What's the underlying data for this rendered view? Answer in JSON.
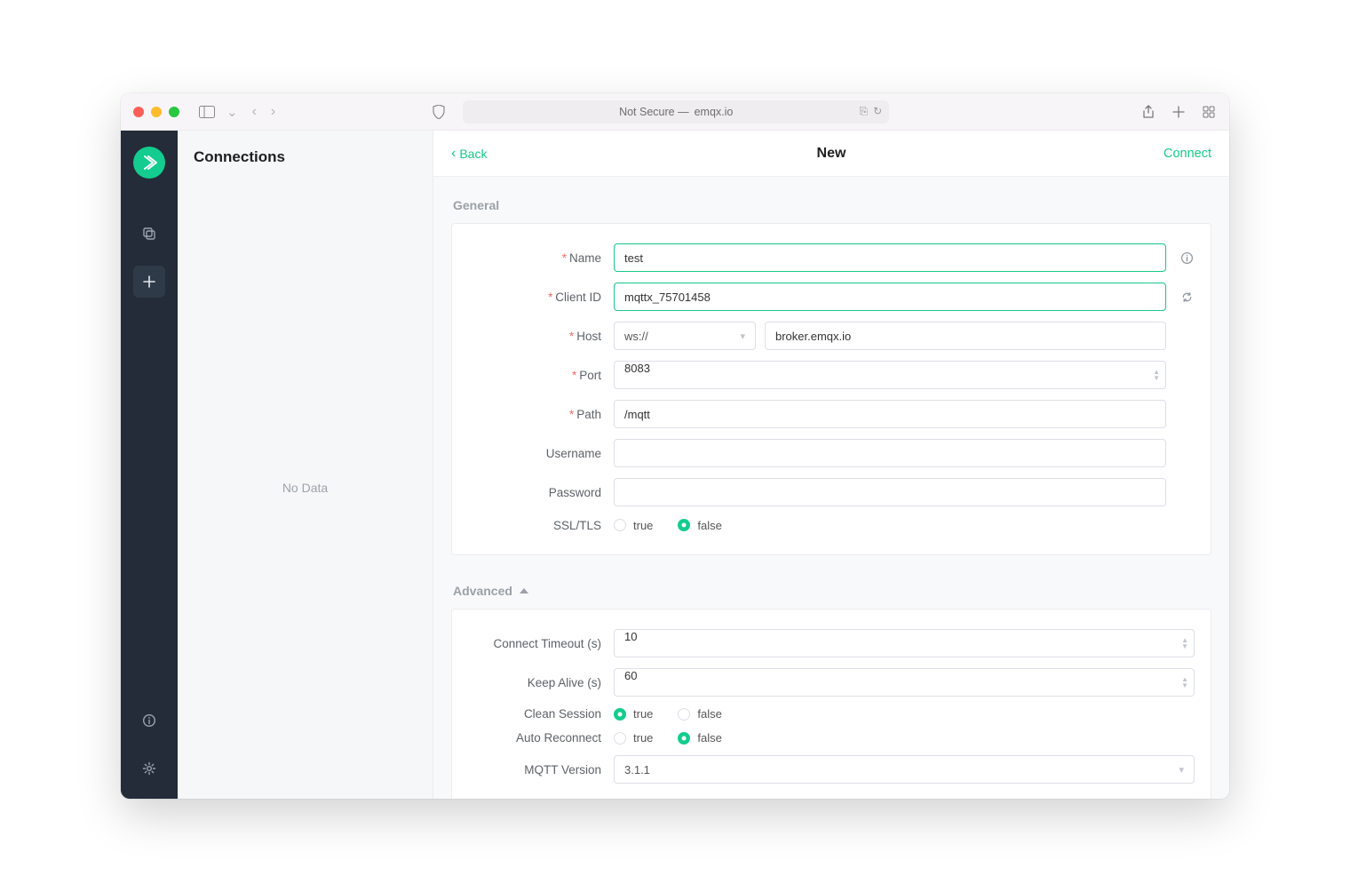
{
  "browser": {
    "address_prefix": "Not Secure —",
    "address_host": "emqx.io"
  },
  "sidebar": {
    "title": "Connections",
    "empty": "No Data"
  },
  "header": {
    "back": "Back",
    "title": "New",
    "connect": "Connect"
  },
  "sections": {
    "general": "General",
    "advanced": "Advanced"
  },
  "labels": {
    "name": "Name",
    "client_id": "Client ID",
    "host": "Host",
    "port": "Port",
    "path": "Path",
    "username": "Username",
    "password": "Password",
    "ssl": "SSL/TLS",
    "connect_timeout": "Connect Timeout (s)",
    "keep_alive": "Keep Alive (s)",
    "clean_session": "Clean Session",
    "auto_reconnect": "Auto Reconnect",
    "mqtt_version": "MQTT Version"
  },
  "values": {
    "name": "test",
    "client_id": "mqttx_75701458",
    "scheme": "ws://",
    "host": "broker.emqx.io",
    "port": "8083",
    "path": "/mqtt",
    "username": "",
    "password": "",
    "ssl": "false",
    "connect_timeout": "10",
    "keep_alive": "60",
    "clean_session": "true",
    "auto_reconnect": "false",
    "mqtt_version": "3.1.1"
  },
  "radio": {
    "true": "true",
    "false": "false"
  }
}
